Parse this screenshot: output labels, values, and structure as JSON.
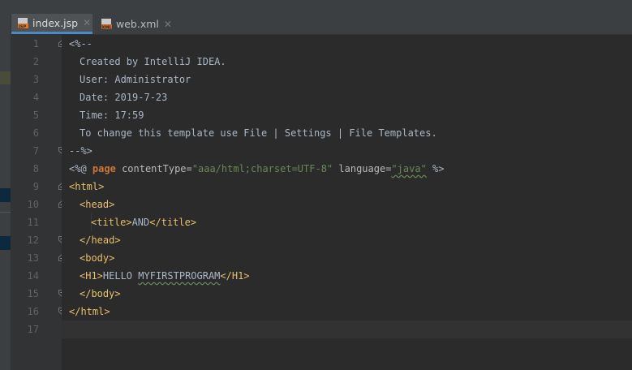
{
  "tabs": [
    {
      "label": "index.jsp",
      "icon": "jsp-file-icon",
      "active": true
    },
    {
      "label": "web.xml",
      "icon": "xml-file-icon",
      "active": false
    }
  ],
  "line_numbers": [
    "1",
    "2",
    "3",
    "4",
    "5",
    "6",
    "7",
    "8",
    "9",
    "10",
    "11",
    "12",
    "13",
    "14",
    "15",
    "16",
    "17"
  ],
  "code": {
    "l1": "<%--",
    "l2": "Created by IntelliJ IDEA.",
    "l3": "User: Administrator",
    "l4": "Date: 2019-7-23",
    "l5": "Time: 17:59",
    "l6": "To change this template use File | Settings | File Templates.",
    "l7": "--%>",
    "l8": {
      "open": "<%@",
      "kw": "page",
      "attr1": "contentType=",
      "val1": "\"aaa/html;charset=UTF-8\"",
      "attr2": "language=",
      "val2": "\"java\"",
      "close": "%>"
    },
    "l9_tag": "<html>",
    "l10_tag": "<head>",
    "l11": {
      "open": "<title>",
      "text": "AND",
      "close": "</title>"
    },
    "l12_tag": "</head>",
    "l13_tag": "<body>",
    "l14": {
      "open": "<H1>",
      "text1": "HELLO ",
      "text2": "MYFIRSTPROGRAM",
      "close": "</H1>"
    },
    "l15_tag": "</body>",
    "l16_tag": "</html>"
  },
  "colors": {
    "background": "#2b2b2b",
    "gutter": "#313335",
    "tag": "#e8bf6a",
    "keyword": "#cc7832",
    "string": "#6a8759",
    "active_tab_underline": "#4a88c7"
  }
}
